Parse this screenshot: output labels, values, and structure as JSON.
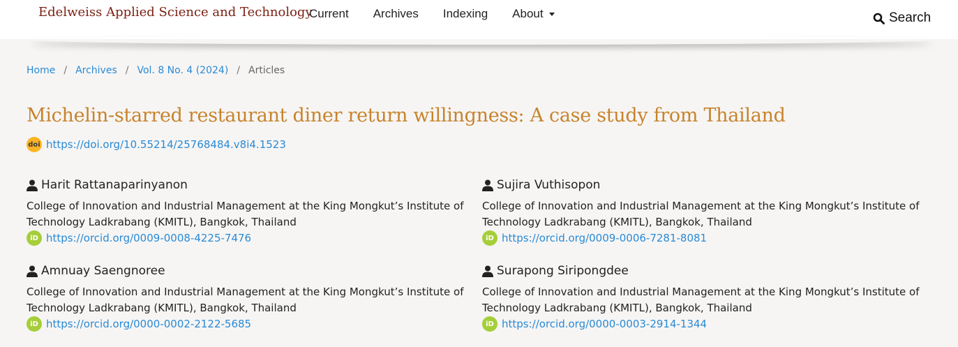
{
  "header": {
    "site_title": "Edelweiss Applied Science and Technology",
    "nav": [
      "Current",
      "Archives",
      "Indexing",
      "About"
    ],
    "search_label": "Search"
  },
  "breadcrumb": {
    "home": "Home",
    "archives": "Archives",
    "issue": "Vol. 8 No. 4 (2024)",
    "current": "Articles",
    "separator": "/"
  },
  "article": {
    "title": "Michelin-starred restaurant diner return willingness: A case study from Thailand",
    "doi_icon_text": "doi",
    "doi": "https://doi.org/10.55214/25768484.v8i4.1523"
  },
  "authors": [
    {
      "name": "Harit Rattanaparinyanon",
      "affiliation": "College of Innovation and Industrial Management at the King Mongkut’s Institute of Technology Ladkrabang (KMITL), Bangkok, Thailand",
      "orcid": "https://orcid.org/0009-0008-4225-7476"
    },
    {
      "name": "Sujira Vuthisopon",
      "affiliation": "College of Innovation and Industrial Management at the King Mongkut’s Institute of Technology Ladkrabang (KMITL), Bangkok, Thailand",
      "orcid": "https://orcid.org/0009-0006-7281-8081"
    },
    {
      "name": "Amnuay Saengnoree",
      "affiliation": "College of Innovation and Industrial Management at the King Mongkut’s Institute of Technology Ladkrabang (KMITL), Bangkok, Thailand",
      "orcid": "https://orcid.org/0000-0002-2122-5685"
    },
    {
      "name": "Surapong Siripongdee",
      "affiliation": "College of Innovation and Industrial Management at the King Mongkut’s Institute of Technology Ladkrabang (KMITL), Bangkok, Thailand",
      "orcid": "https://orcid.org/0000-0003-2914-1344"
    }
  ],
  "orcid_icon_text": "iD",
  "colors": {
    "title": "#c8832c",
    "link": "#2a8ad4",
    "site_title": "#7a1f12",
    "orcid": "#a6ce39",
    "doi": "#fcb425"
  }
}
